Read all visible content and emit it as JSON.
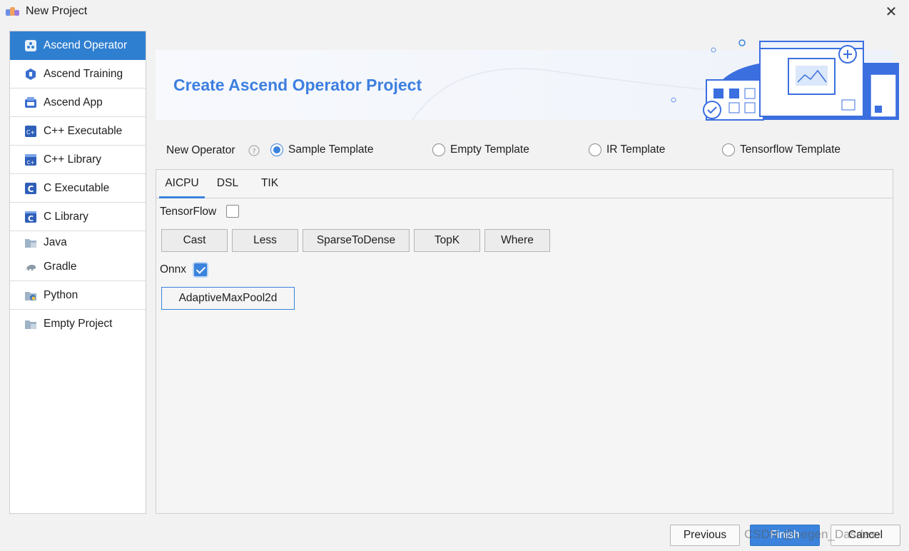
{
  "window": {
    "title": "New Project"
  },
  "sidebar": {
    "items": [
      {
        "label": "Ascend Operator",
        "icon": "ascend-operator-icon",
        "active": true
      },
      {
        "label": "Ascend Training",
        "icon": "ascend-training-icon"
      },
      {
        "label": "Ascend App",
        "icon": "ascend-app-icon"
      },
      {
        "label": "C++ Executable",
        "icon": "cpp-icon"
      },
      {
        "label": "C++ Library",
        "icon": "cpp-library-icon"
      },
      {
        "label": "C Executable",
        "icon": "c-icon"
      },
      {
        "label": "C Library",
        "icon": "c-library-icon"
      },
      {
        "label": "Java",
        "icon": "folder-icon"
      },
      {
        "label": "Gradle",
        "icon": "gradle-icon"
      },
      {
        "label": "Python",
        "icon": "python-folder-icon"
      },
      {
        "label": "Empty Project",
        "icon": "folder-icon"
      }
    ]
  },
  "banner": {
    "title": "Create Ascend Operator Project"
  },
  "new_operator": {
    "label": "New Operator",
    "options": [
      "Sample Template",
      "Empty Template",
      "IR Template",
      "Tensorflow Template"
    ],
    "selected": "Sample Template"
  },
  "tabs": [
    "AICPU",
    "DSL",
    "TIK"
  ],
  "active_tab": "AICPU",
  "groups": {
    "tensorflow": {
      "label": "TensorFlow",
      "checked": false,
      "ops": [
        "Cast",
        "Less",
        "SparseToDense",
        "TopK",
        "Where"
      ]
    },
    "onnx": {
      "label": "Onnx",
      "checked": true,
      "ops": [
        "AdaptiveMaxPool2d"
      ]
    }
  },
  "footer": {
    "previous": "Previous",
    "finish": "Finish",
    "cancel": "Cancel"
  },
  "watermark": "CSDN @uegen_Dasdes",
  "colors": {
    "accent": "#3b83dc",
    "sidebar_active": "#2f7fd1",
    "banner_title": "#3d7fe0"
  }
}
